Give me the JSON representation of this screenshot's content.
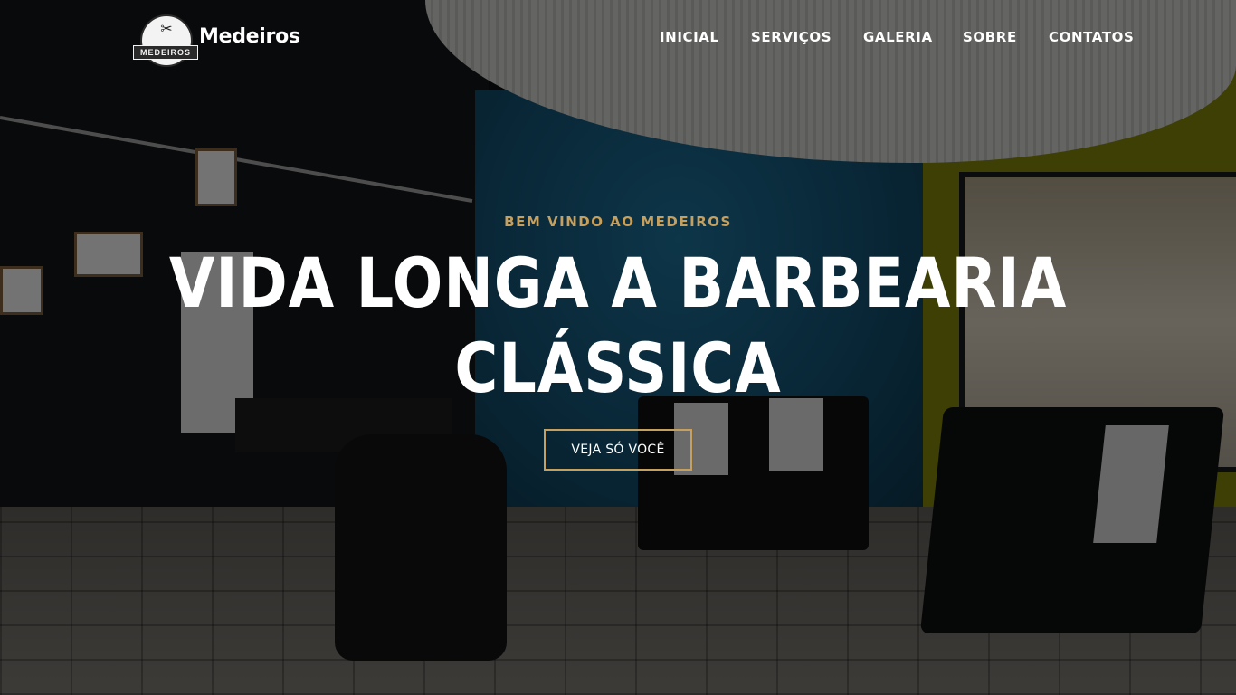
{
  "header": {
    "brand_name": "Medeiros",
    "logo_text": "MEDEIROS",
    "logo_icon": "scissors-icon",
    "nav": [
      {
        "label": "INICIAL"
      },
      {
        "label": "SERVIÇOS"
      },
      {
        "label": "GALERIA"
      },
      {
        "label": "SOBRE"
      },
      {
        "label": "CONTATOS"
      }
    ]
  },
  "hero": {
    "eyebrow": "BEM VINDO AO MEDEIROS",
    "headline_line1": "VIDA LONGA A BARBEARIA",
    "headline_line2": "CLÁSSICA",
    "cta_label": "VEJA SÓ VOCÊ"
  },
  "colors": {
    "accent_gold": "#c6a05e",
    "text_white": "#ffffff"
  }
}
